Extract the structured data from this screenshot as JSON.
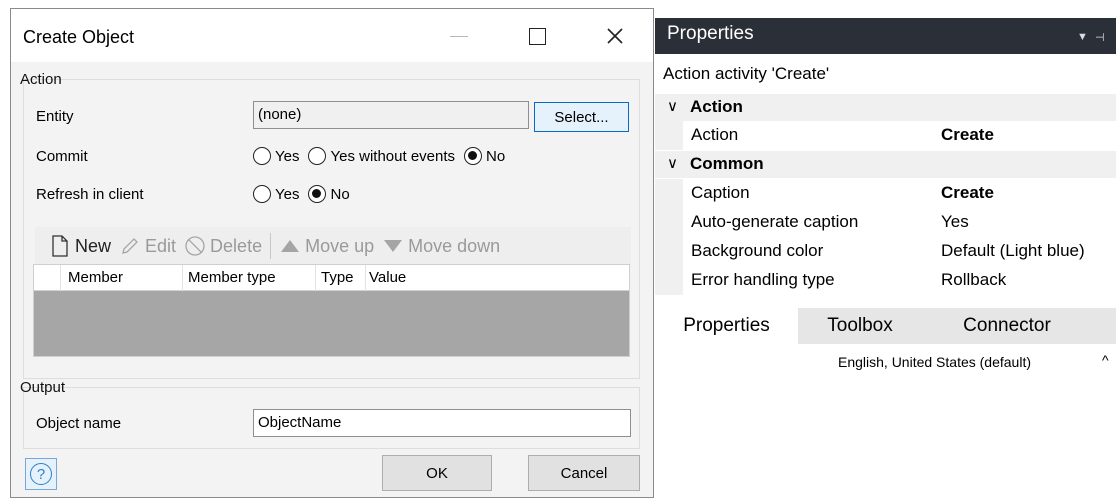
{
  "dialog": {
    "title": "Create Object",
    "action_group": {
      "label": "Action",
      "entity_label": "Entity",
      "entity_value": "(none)",
      "select_button": "Select...",
      "commit_label": "Commit",
      "commit_options": [
        {
          "label": "Yes",
          "selected": false
        },
        {
          "label": "Yes without events",
          "selected": false
        },
        {
          "label": "No",
          "selected": true
        }
      ],
      "refresh_label": "Refresh in client",
      "refresh_options": [
        {
          "label": "Yes",
          "selected": false
        },
        {
          "label": "No",
          "selected": true
        }
      ],
      "toolbar": {
        "new": "New",
        "edit": "Edit",
        "delete": "Delete",
        "move_up": "Move up",
        "move_down": "Move down"
      },
      "grid_columns": [
        "Member",
        "Member type",
        "Type",
        "Value"
      ]
    },
    "output_group": {
      "label": "Output",
      "object_name_label": "Object name",
      "object_name_value": "ObjectName"
    },
    "ok_button": "OK",
    "cancel_button": "Cancel",
    "help_glyph": "?"
  },
  "properties": {
    "title": "Properties",
    "subtitle": "Action activity 'Create'",
    "categories": [
      {
        "label": "Action",
        "rows": [
          {
            "name": "Action",
            "value": "Create",
            "bold": true
          }
        ]
      },
      {
        "label": "Common",
        "rows": [
          {
            "name": "Caption",
            "value": "Create",
            "bold": true
          },
          {
            "name": "Auto-generate caption",
            "value": "Yes",
            "bold": false
          },
          {
            "name": "Background color",
            "value": "Default (Light blue)",
            "bold": false
          },
          {
            "name": "Error handling type",
            "value": "Rollback",
            "bold": false
          }
        ]
      }
    ],
    "tabs": [
      {
        "label": "Properties",
        "active": true
      },
      {
        "label": "Toolbox",
        "active": false
      },
      {
        "label": "Connector",
        "active": false
      }
    ],
    "status_language": "English, United States (default)"
  },
  "colors": {
    "titlebar_dark": "#2a2f38",
    "accent_blue": "#0a68c7",
    "grid_empty": "#a6a6a6"
  }
}
